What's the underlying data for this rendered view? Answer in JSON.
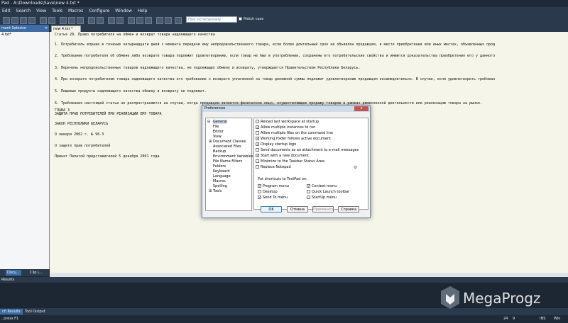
{
  "window": {
    "title": "Pad - A:\\Downloads\\Save\\new 4.txt *"
  },
  "menubar": {
    "items": [
      "Edit",
      "Search",
      "View",
      "Tools",
      "Macros",
      "Configure",
      "Window",
      "Help"
    ]
  },
  "toolbar": {
    "search_placeholder": "Find incrementally",
    "match_case_label": "Match case"
  },
  "document_selector": {
    "title": "ment Selector",
    "item": "4.txt*"
  },
  "left_tabs": [
    "Docu...",
    "Clip L..."
  ],
  "doc_tab": {
    "label": "new 4.txt *"
  },
  "editor": {
    "lines": [
      "Статья 28. Право потребителя на обмен и возврат товара надлежащего качества",
      "1. Потребитель вправе в течение четырнадцати дней с момента передачи ему непродовольственного товара, если более длительный срок не объявлен продавцом, в месте приобретения или иных местах, объявленных прод",
      "2. Требование потребителя об обмене либо возврате товара подлежит удовлетворению, если товар не был в употреблении, сохранены его потребительские свойства и имеются доказательства приобретения его у данного",
      "3. Перечень непродовольственных товаров надлежащего качества, не подлежащих обмену и возврату, утверждается Правительством Республики Беларусь.",
      "4. При возврате потребителем товара надлежащего качества его требование о возврате уплаченной за товар денежной суммы подлежит удовлетворению продавцом незамедлительно. В случае, если удовлетворить требован",
      "5. Пищевые продукты надлежащего качества обмену и возврату не подлежат.",
      "6. Требования настоящей статьи не распространяются на случаи, когда продавцом является физическое лицо, осуществляющее продажу товаров в рамках ремесленной деятельности или реализацию товара на рынке.",
      "ГЛАВА 3",
      "ЗАЩИТА ПРАВ ПОТРЕБИТЕЛЕЙ ПРИ РЕАЛИЗАЦИИ ЕМУ ТОВАРА",
      "ЗАКОН РЕСПУБЛИКИ БЕЛАРУСЬ",
      "9 января 2002 г. № 90-З",
      "О защите прав потребителей",
      "Принят Палатой представителей 5 декабря 2001 года"
    ]
  },
  "results_panel": {
    "title": "Results"
  },
  "bottom_tabs": [
    "ch Results",
    "Tool Output"
  ],
  "statusbar": {
    "hint": ", press F1",
    "line": "24",
    "col": "9",
    "ins": "INS",
    "mode": "Win"
  },
  "watermark": {
    "brand": "MegaProgz"
  },
  "dialog": {
    "title": "Preferences",
    "close_label": "x",
    "tree": [
      {
        "label": "General",
        "level": 1,
        "selected": true
      },
      {
        "label": "File",
        "level": 1
      },
      {
        "label": "Editor",
        "level": 1
      },
      {
        "label": "View",
        "level": 1
      },
      {
        "label": "Document Classes",
        "level": 1,
        "expander": "⊞"
      },
      {
        "label": "Associated Files",
        "level": 1
      },
      {
        "label": "Backup",
        "level": 1
      },
      {
        "label": "Environment Variables",
        "level": 1
      },
      {
        "label": "File Name Filters",
        "level": 1
      },
      {
        "label": "Folders",
        "level": 1
      },
      {
        "label": "Keyboard",
        "level": 1
      },
      {
        "label": "Language",
        "level": 1
      },
      {
        "label": "Macros",
        "level": 1
      },
      {
        "label": "Spelling",
        "level": 1
      },
      {
        "label": "Tools",
        "level": 1,
        "expander": "⊞"
      }
    ],
    "options": [
      {
        "label": "Reload last workspace at startup",
        "checked": false
      },
      {
        "label": "Allow multiple instances to run",
        "checked": true
      },
      {
        "label": "Allow multiple files on the command line",
        "checked": false
      },
      {
        "label": "Working folder follows active document",
        "checked": true
      },
      {
        "label": "Display startup logo",
        "checked": true
      },
      {
        "label": "Send documents as an attachment to e-mail messages",
        "checked": false
      },
      {
        "label": "Start with a new document",
        "checked": true
      },
      {
        "label": "Minimize to the Taskbar Status Area",
        "checked": false
      },
      {
        "label": "Replace Notepad",
        "checked": false
      }
    ],
    "shortcuts_header": "Put shortcuts to TextPad on:",
    "shortcuts_left": [
      {
        "label": "Program menu",
        "checked": true
      },
      {
        "label": "Desktop",
        "checked": false
      },
      {
        "label": "Send To menu",
        "checked": true
      }
    ],
    "shortcuts_right": [
      {
        "label": "Context menu",
        "checked": true
      },
      {
        "label": "Quick Launch toolbar",
        "checked": false
      },
      {
        "label": "StartUp menu",
        "checked": false
      }
    ],
    "buttons": {
      "ok": "OK",
      "cancel": "Отмена",
      "apply": "Применить",
      "help": "Справка"
    }
  }
}
